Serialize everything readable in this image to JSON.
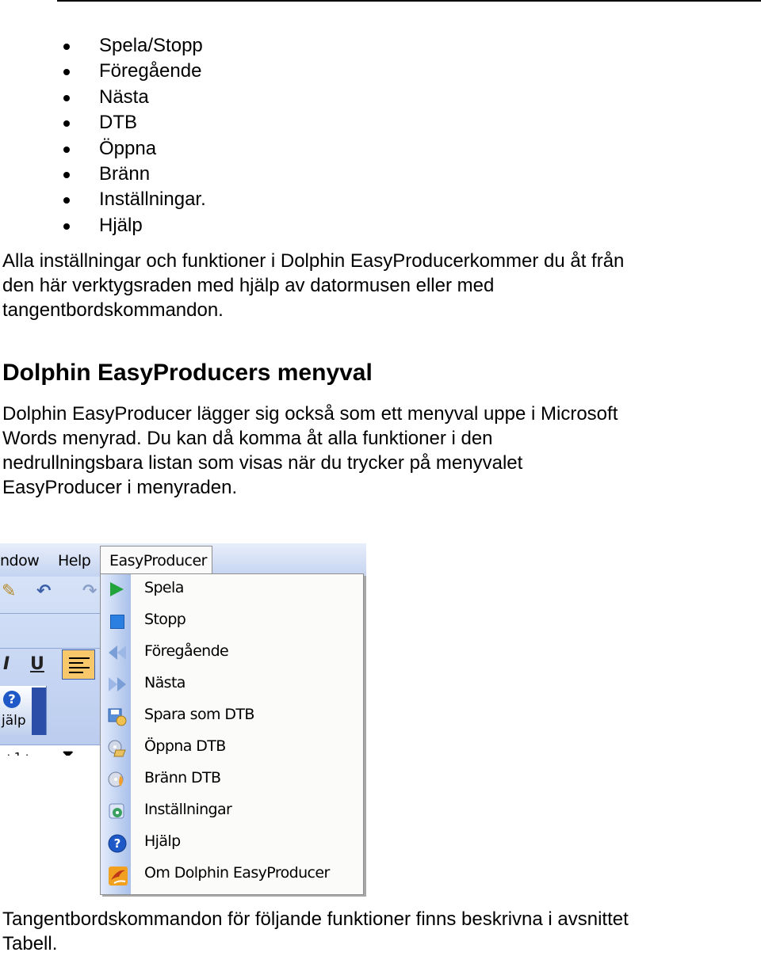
{
  "bullets": [
    "Spela/Stopp",
    "Föregående",
    "Nästa",
    "DTB",
    "Öppna",
    "Bränn",
    "Inställningar.",
    "Hjälp"
  ],
  "paragraph1": [
    "Alla inställningar och funktioner i Dolphin EasyProducerkommer du åt från",
    "den här verktygsraden med hjälp av datormusen eller med",
    "tangentbordskommandon."
  ],
  "heading": "Dolphin EasyProducers menyval",
  "paragraph2": [
    "Dolphin EasyProducer lägger sig också som ett menyval uppe i Microsoft",
    "Words menyrad.  Du kan då komma åt alla funktioner i den",
    "nedrullningsbara listan som visas när du trycker på menyvalet",
    "EasyProducer i menyraden."
  ],
  "screenshot": {
    "menubar": {
      "window": "ndow",
      "help": "Help",
      "easyproducer": "EasyProducer"
    },
    "help_button_label": "jälp",
    "ruler_text": "·ı·1·ı·",
    "menu_items": [
      {
        "label": "Spela",
        "icon": "play-icon",
        "color": "#22a33c"
      },
      {
        "label": "Stopp",
        "icon": "stop-icon",
        "color": "#2b7fe0"
      },
      {
        "label": "Föregående",
        "icon": "rewind-icon",
        "color": "#7a9fd6"
      },
      {
        "label": "Nästa",
        "icon": "forward-icon",
        "color": "#7a9fd6"
      },
      {
        "label": "Spara som DTB",
        "icon": "save-dtb-icon",
        "color": "#5a8fd8"
      },
      {
        "label": "Öppna DTB",
        "icon": "open-dtb-icon",
        "color": "#d9a441"
      },
      {
        "label": "Bränn DTB",
        "icon": "burn-dtb-icon",
        "color": "#e0b64a"
      },
      {
        "label": "Inställningar",
        "icon": "settings-icon",
        "color": "#3aa060"
      },
      {
        "label": "Hjälp",
        "icon": "help-icon",
        "color": "#1f59c8"
      },
      {
        "label": "Om Dolphin EasyProducer",
        "icon": "dolphin-logo-icon",
        "color": "#e8722a"
      }
    ]
  },
  "caption": [
    "Tangentbordskommandon för följande funktioner finns beskrivna i avsnittet",
    "Tabell."
  ]
}
